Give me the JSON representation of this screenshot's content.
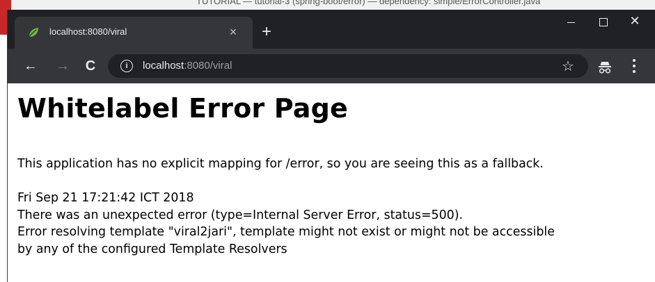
{
  "background": {
    "window_title": "TUTORIAL — tutorial-3 (spring-boot/error) — dependency: simple/ErrorController.java"
  },
  "browser": {
    "tab": {
      "title": "localhost:8080/viral",
      "close_label": "×"
    },
    "new_tab_label": "+",
    "window_controls": {
      "close_label": "✕"
    },
    "nav": {
      "back_label": "←",
      "forward_label": "→",
      "reload_label": "C"
    },
    "omnibox": {
      "info_label": "i",
      "url_host": "localhost",
      "url_rest": ":8080/viral"
    },
    "star_label": "☆"
  },
  "page": {
    "title": "Whitelabel Error Page",
    "message": "This application has no explicit mapping for /error, so you are seeing this as a fallback.",
    "timestamp": "Fri Sep 21 17:21:42 ICT 2018",
    "error_line": "There was an unexpected error (type=Internal Server Error, status=500).",
    "detail_line_1": "Error resolving template \"viral2jari\", template might not exist or might not be accessible",
    "detail_line_2": "by any of the configured Template Resolvers"
  },
  "colors": {
    "titlebar": "#202124",
    "toolbar": "#35363a",
    "favicon": "#6db33f"
  }
}
